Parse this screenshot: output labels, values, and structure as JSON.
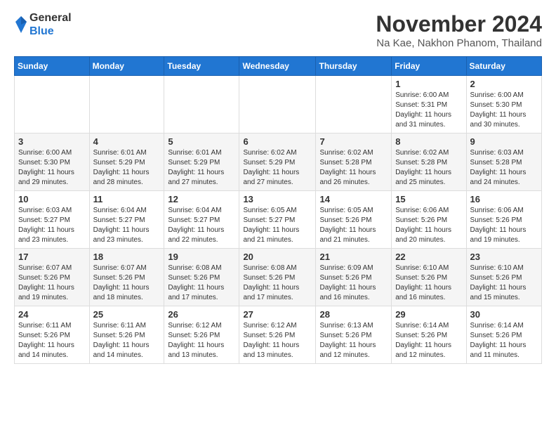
{
  "logo": {
    "general": "General",
    "blue": "Blue"
  },
  "header": {
    "month": "November 2024",
    "location": "Na Kae, Nakhon Phanom, Thailand"
  },
  "days_of_week": [
    "Sunday",
    "Monday",
    "Tuesday",
    "Wednesday",
    "Thursday",
    "Friday",
    "Saturday"
  ],
  "weeks": [
    [
      {
        "day": "",
        "info": ""
      },
      {
        "day": "",
        "info": ""
      },
      {
        "day": "",
        "info": ""
      },
      {
        "day": "",
        "info": ""
      },
      {
        "day": "",
        "info": ""
      },
      {
        "day": "1",
        "info": "Sunrise: 6:00 AM\nSunset: 5:31 PM\nDaylight: 11 hours and 31 minutes."
      },
      {
        "day": "2",
        "info": "Sunrise: 6:00 AM\nSunset: 5:30 PM\nDaylight: 11 hours and 30 minutes."
      }
    ],
    [
      {
        "day": "3",
        "info": "Sunrise: 6:00 AM\nSunset: 5:30 PM\nDaylight: 11 hours and 29 minutes."
      },
      {
        "day": "4",
        "info": "Sunrise: 6:01 AM\nSunset: 5:29 PM\nDaylight: 11 hours and 28 minutes."
      },
      {
        "day": "5",
        "info": "Sunrise: 6:01 AM\nSunset: 5:29 PM\nDaylight: 11 hours and 27 minutes."
      },
      {
        "day": "6",
        "info": "Sunrise: 6:02 AM\nSunset: 5:29 PM\nDaylight: 11 hours and 27 minutes."
      },
      {
        "day": "7",
        "info": "Sunrise: 6:02 AM\nSunset: 5:28 PM\nDaylight: 11 hours and 26 minutes."
      },
      {
        "day": "8",
        "info": "Sunrise: 6:02 AM\nSunset: 5:28 PM\nDaylight: 11 hours and 25 minutes."
      },
      {
        "day": "9",
        "info": "Sunrise: 6:03 AM\nSunset: 5:28 PM\nDaylight: 11 hours and 24 minutes."
      }
    ],
    [
      {
        "day": "10",
        "info": "Sunrise: 6:03 AM\nSunset: 5:27 PM\nDaylight: 11 hours and 23 minutes."
      },
      {
        "day": "11",
        "info": "Sunrise: 6:04 AM\nSunset: 5:27 PM\nDaylight: 11 hours and 23 minutes."
      },
      {
        "day": "12",
        "info": "Sunrise: 6:04 AM\nSunset: 5:27 PM\nDaylight: 11 hours and 22 minutes."
      },
      {
        "day": "13",
        "info": "Sunrise: 6:05 AM\nSunset: 5:27 PM\nDaylight: 11 hours and 21 minutes."
      },
      {
        "day": "14",
        "info": "Sunrise: 6:05 AM\nSunset: 5:26 PM\nDaylight: 11 hours and 21 minutes."
      },
      {
        "day": "15",
        "info": "Sunrise: 6:06 AM\nSunset: 5:26 PM\nDaylight: 11 hours and 20 minutes."
      },
      {
        "day": "16",
        "info": "Sunrise: 6:06 AM\nSunset: 5:26 PM\nDaylight: 11 hours and 19 minutes."
      }
    ],
    [
      {
        "day": "17",
        "info": "Sunrise: 6:07 AM\nSunset: 5:26 PM\nDaylight: 11 hours and 19 minutes."
      },
      {
        "day": "18",
        "info": "Sunrise: 6:07 AM\nSunset: 5:26 PM\nDaylight: 11 hours and 18 minutes."
      },
      {
        "day": "19",
        "info": "Sunrise: 6:08 AM\nSunset: 5:26 PM\nDaylight: 11 hours and 17 minutes."
      },
      {
        "day": "20",
        "info": "Sunrise: 6:08 AM\nSunset: 5:26 PM\nDaylight: 11 hours and 17 minutes."
      },
      {
        "day": "21",
        "info": "Sunrise: 6:09 AM\nSunset: 5:26 PM\nDaylight: 11 hours and 16 minutes."
      },
      {
        "day": "22",
        "info": "Sunrise: 6:10 AM\nSunset: 5:26 PM\nDaylight: 11 hours and 16 minutes."
      },
      {
        "day": "23",
        "info": "Sunrise: 6:10 AM\nSunset: 5:26 PM\nDaylight: 11 hours and 15 minutes."
      }
    ],
    [
      {
        "day": "24",
        "info": "Sunrise: 6:11 AM\nSunset: 5:26 PM\nDaylight: 11 hours and 14 minutes."
      },
      {
        "day": "25",
        "info": "Sunrise: 6:11 AM\nSunset: 5:26 PM\nDaylight: 11 hours and 14 minutes."
      },
      {
        "day": "26",
        "info": "Sunrise: 6:12 AM\nSunset: 5:26 PM\nDaylight: 11 hours and 13 minutes."
      },
      {
        "day": "27",
        "info": "Sunrise: 6:12 AM\nSunset: 5:26 PM\nDaylight: 11 hours and 13 minutes."
      },
      {
        "day": "28",
        "info": "Sunrise: 6:13 AM\nSunset: 5:26 PM\nDaylight: 11 hours and 12 minutes."
      },
      {
        "day": "29",
        "info": "Sunrise: 6:14 AM\nSunset: 5:26 PM\nDaylight: 11 hours and 12 minutes."
      },
      {
        "day": "30",
        "info": "Sunrise: 6:14 AM\nSunset: 5:26 PM\nDaylight: 11 hours and 11 minutes."
      }
    ]
  ]
}
